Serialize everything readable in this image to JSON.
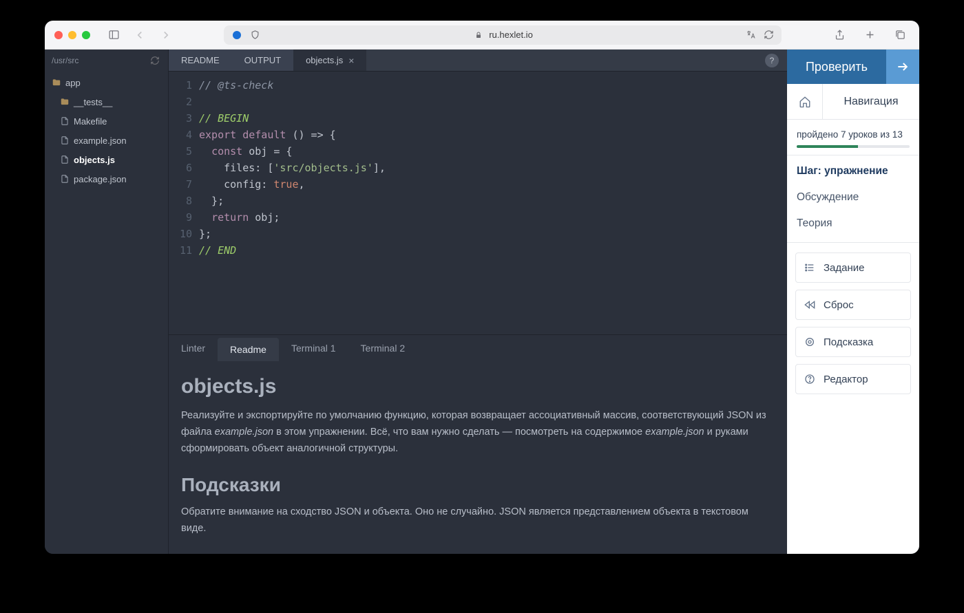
{
  "browser": {
    "url_host": "ru.hexlet.io"
  },
  "filetree": {
    "path": "/usr/src",
    "nodes": [
      {
        "label": "app",
        "type": "folder",
        "depth": 0
      },
      {
        "label": "__tests__",
        "type": "folder",
        "depth": 1
      },
      {
        "label": "Makefile",
        "type": "file",
        "depth": 1
      },
      {
        "label": "example.json",
        "type": "file",
        "depth": 1
      },
      {
        "label": "objects.js",
        "type": "file",
        "depth": 1,
        "active": true
      },
      {
        "label": "package.json",
        "type": "file",
        "depth": 1
      }
    ]
  },
  "editor_tabs": [
    {
      "label": "README",
      "active": false
    },
    {
      "label": "OUTPUT",
      "active": false
    },
    {
      "label": "objects.js",
      "active": true,
      "closable": true
    }
  ],
  "code_lines": [
    [
      {
        "t": "// @ts-check",
        "c": "tk-comment"
      }
    ],
    [
      {
        "t": "",
        "c": ""
      }
    ],
    [
      {
        "t": "// BEGIN",
        "c": "tk-begin"
      }
    ],
    [
      {
        "t": "export",
        "c": "tk-kw"
      },
      {
        "t": " ",
        "c": ""
      },
      {
        "t": "default",
        "c": "tk-kw"
      },
      {
        "t": " () => {",
        "c": "tk-punct"
      }
    ],
    [
      {
        "t": "  ",
        "c": ""
      },
      {
        "t": "const",
        "c": "tk-kw"
      },
      {
        "t": " obj = {",
        "c": "tk-punct"
      }
    ],
    [
      {
        "t": "    files: [",
        "c": "tk-punct"
      },
      {
        "t": "'src/objects.js'",
        "c": "tk-str"
      },
      {
        "t": "],",
        "c": "tk-punct"
      }
    ],
    [
      {
        "t": "    config: ",
        "c": "tk-punct"
      },
      {
        "t": "true",
        "c": "tk-true"
      },
      {
        "t": ",",
        "c": "tk-punct"
      }
    ],
    [
      {
        "t": "  };",
        "c": "tk-punct"
      }
    ],
    [
      {
        "t": "  ",
        "c": ""
      },
      {
        "t": "return",
        "c": "tk-kw"
      },
      {
        "t": " obj;",
        "c": "tk-punct"
      }
    ],
    [
      {
        "t": "};",
        "c": "tk-punct"
      }
    ],
    [
      {
        "t": "// END",
        "c": "tk-begin"
      }
    ]
  ],
  "bottom_tabs": [
    {
      "label": "Linter",
      "active": false
    },
    {
      "label": "Readme",
      "active": true
    },
    {
      "label": "Terminal 1",
      "active": false
    },
    {
      "label": "Terminal 2",
      "active": false
    }
  ],
  "readme": {
    "h1": "objects.js",
    "p1_a": "Реализуйте и экспортируйте по умолчанию функцию, которая возвращает ассоциативный массив, соответствующий JSON из файла ",
    "p1_em1": "example.json",
    "p1_b": " в этом упражнении. Всё, что вам нужно сделать — посмотреть на содержимое ",
    "p1_em2": "example.json",
    "p1_c": " и руками сформировать объект аналогичной структуры.",
    "h2": "Подсказки",
    "p2": "Обратите внимание на сходство JSON и объекта. Оно не случайно. JSON является представлением объекта в текстовом виде."
  },
  "right": {
    "check_label": "Проверить",
    "nav_label": "Навигация",
    "progress_text": "пройдено 7 уроков из 13",
    "progress_pct": 54,
    "nav_items": [
      {
        "label": "Шаг: упражнение",
        "active": true
      },
      {
        "label": "Обсуждение",
        "active": false
      },
      {
        "label": "Теория",
        "active": false
      }
    ],
    "cards": [
      {
        "label": "Задание",
        "icon": "list"
      },
      {
        "label": "Сброс",
        "icon": "rewind"
      },
      {
        "label": "Подсказка",
        "icon": "target"
      },
      {
        "label": "Редактор",
        "icon": "help"
      }
    ]
  }
}
